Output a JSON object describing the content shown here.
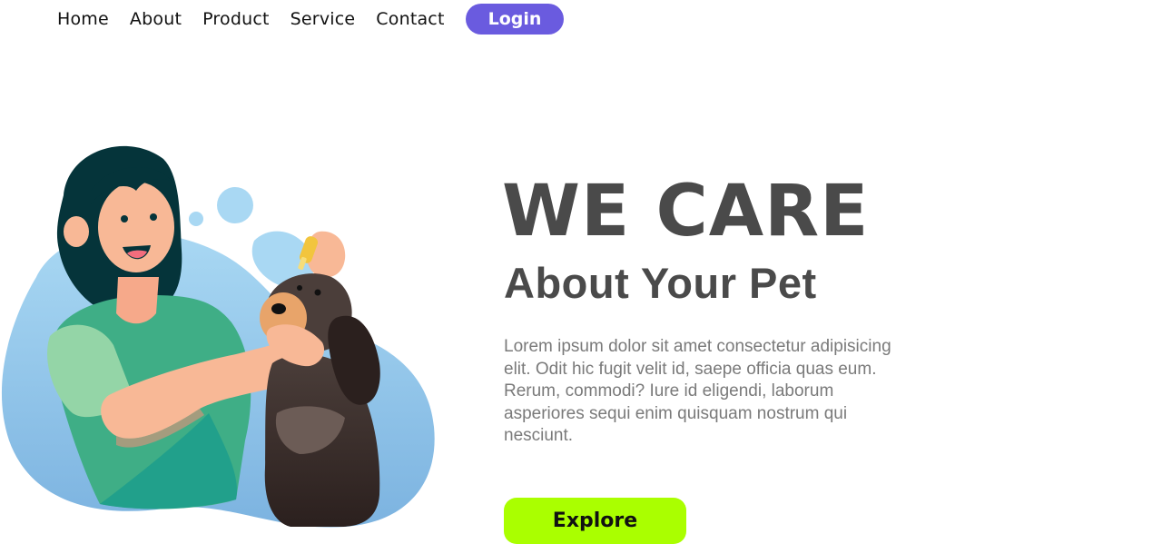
{
  "nav": {
    "items": [
      {
        "label": "Home"
      },
      {
        "label": "About"
      },
      {
        "label": "Product"
      },
      {
        "label": "Service"
      },
      {
        "label": "Contact"
      }
    ],
    "login_label": "Login"
  },
  "hero": {
    "title": "WE CARE",
    "subtitle": "About Your Pet",
    "text": "Lorem ipsum dolor sit amet consectetur adipisicing elit. Odit hic fugit velit id, saepe officia quas eum. Rerum, commodi? Iure id eligendi, laborum asperiores sequi enim quisquam nostrum qui nesciunt.",
    "cta_label": "Explore"
  },
  "illustration": {
    "icon": "woman-with-dog-illustration"
  },
  "colors": {
    "accent": "#6a5bdf",
    "cta": "#aaff00",
    "heading": "#4a4a4a",
    "body_text": "#7a7a7a",
    "blob": "#9fd0ef"
  }
}
